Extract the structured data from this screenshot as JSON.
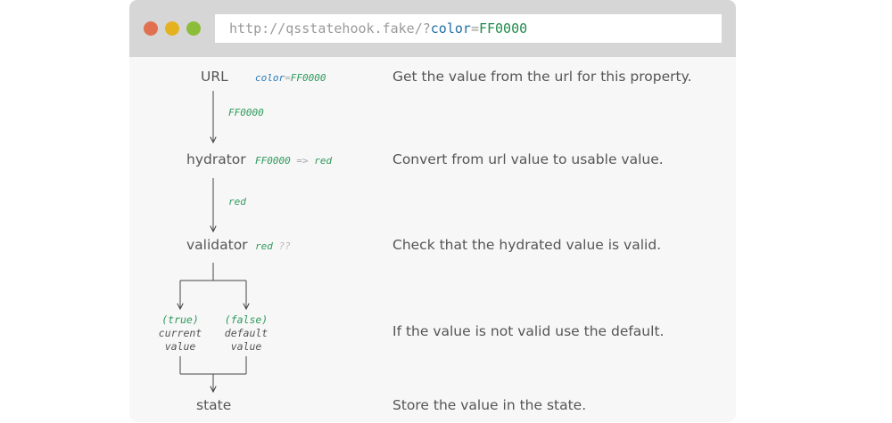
{
  "browser": {
    "url_base": "http://qsstatehook.fake/?",
    "url_param_key": "color",
    "url_param_eq": "=",
    "url_param_value": "FF0000"
  },
  "nodes": {
    "url": "URL",
    "hydrator": "hydrator",
    "validator": "validator",
    "state": "state"
  },
  "annotations": {
    "url_key": "color",
    "url_eq": "=",
    "url_value": "FF0000",
    "edge_url_hydrator": "FF0000",
    "hydrator_in": "FF0000",
    "hydrator_arrow": "=>",
    "hydrator_out": "red",
    "edge_hydrator_validator": "red",
    "validator_value": "red",
    "validator_question": "??"
  },
  "branches": {
    "true_condition": "(true)",
    "true_line1": "current",
    "true_line2": "value",
    "false_condition": "(false)",
    "false_line1": "default",
    "false_line2": "value"
  },
  "descriptions": {
    "url": "Get the value from the url for this property.",
    "hydrator": "Convert from url value to usable value.",
    "validator": "Check that the hydrated value is valid.",
    "fallback": "If the value is not valid use the default.",
    "state": "Store the value in the state."
  }
}
